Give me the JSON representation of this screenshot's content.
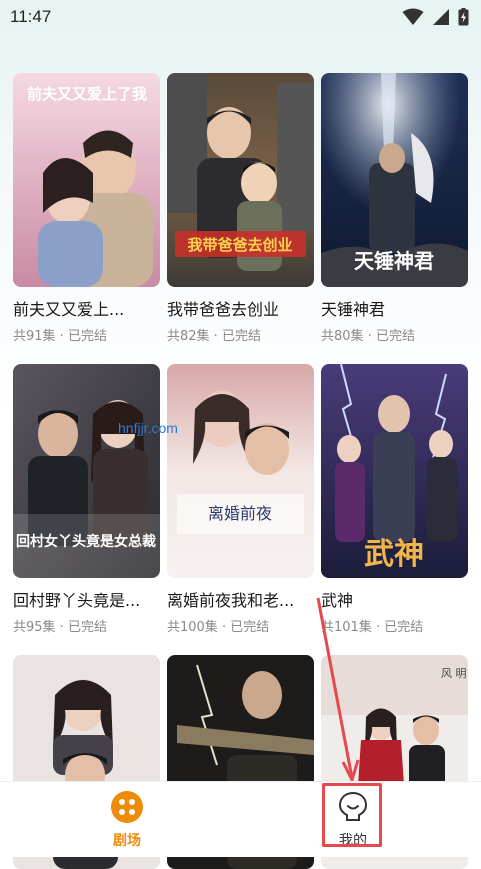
{
  "status_bar": {
    "time": "11:47"
  },
  "dramas": [
    {
      "title": "前夫又又爱上...",
      "meta": "共91集 · 已完结",
      "poster_text": "前夫又又爱上了我",
      "colors": [
        "#f5d9e2",
        "#d98ca6",
        "#8aa0c8"
      ]
    },
    {
      "title": "我带爸爸去创业",
      "meta": "共82集 · 已完结",
      "poster_text": "我带爸爸去创业",
      "colors": [
        "#3d3a36",
        "#7b6248",
        "#b48a55"
      ]
    },
    {
      "title": "天锤神君",
      "meta": "共80集 · 已完结",
      "poster_text": "天锤神君",
      "colors": [
        "#1f2f55",
        "#3a5a8c",
        "#8fa7c7"
      ]
    },
    {
      "title": "回村野丫头竟是...",
      "meta": "共95集 · 已完结",
      "poster_text": "回村女丫头竟是女总裁",
      "colors": [
        "#2a2a2e",
        "#5b5560",
        "#d6d6d6"
      ]
    },
    {
      "title": "离婚前夜我和老...",
      "meta": "共100集 · 已完结",
      "poster_text": "离婚前夜",
      "colors": [
        "#f3e7e4",
        "#d8a8a8",
        "#7a6b76"
      ]
    },
    {
      "title": "武神",
      "meta": "共101集 · 已完结",
      "poster_text": "武神",
      "colors": [
        "#1b1d3a",
        "#4a3b7a",
        "#b07a2a"
      ]
    },
    {
      "title": "",
      "meta": "",
      "poster_text": "",
      "colors": [
        "#e9e4e2",
        "#c9b8b2",
        "#45404a"
      ]
    },
    {
      "title": "",
      "meta": "",
      "poster_text": "",
      "colors": [
        "#1e1c1a",
        "#5d4e3f",
        "#c0b4a0"
      ]
    },
    {
      "title": "",
      "meta": "",
      "poster_text": "风 明 睡",
      "colors": [
        "#f0ecea",
        "#c8b9b4",
        "#b3202b"
      ]
    }
  ],
  "watermark": "hnfjjr.com",
  "tabbar": {
    "tabs": [
      {
        "label": "剧场",
        "icon": "theater-icon",
        "active": true
      },
      {
        "label": "我的",
        "icon": "profile-icon",
        "active": false
      }
    ]
  },
  "colors": {
    "accent": "#f08a0a",
    "annotation": "#e5484d"
  }
}
